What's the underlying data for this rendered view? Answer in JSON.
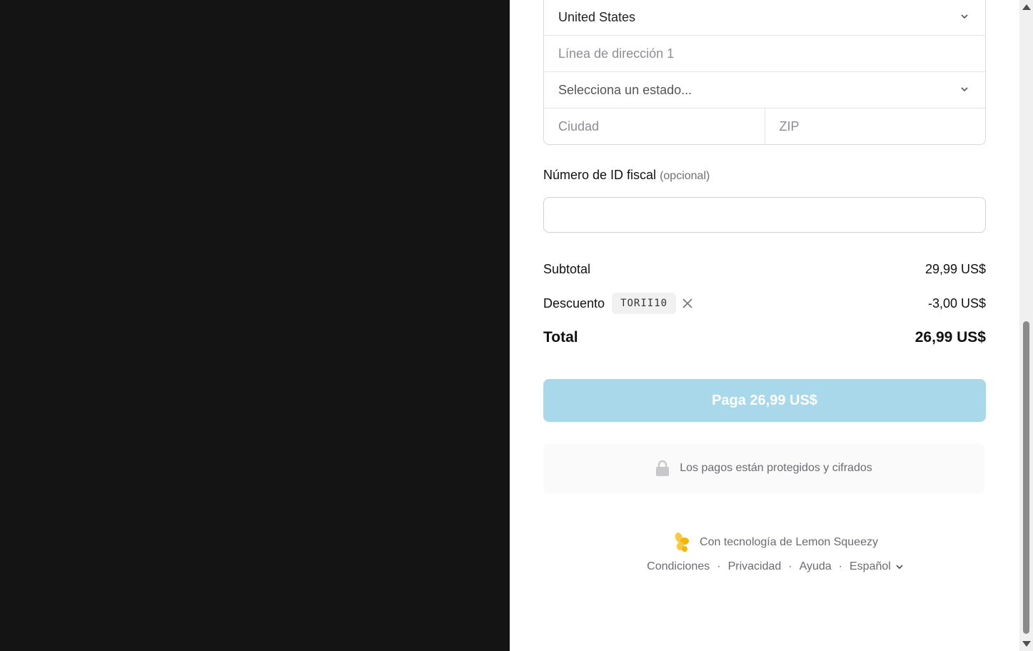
{
  "address": {
    "country": "United States",
    "address_line1_placeholder": "Línea de dirección 1",
    "state_placeholder": "Selecciona un estado...",
    "city_placeholder": "Ciudad",
    "zip_placeholder": "ZIP"
  },
  "tax": {
    "label": "Número de ID fiscal",
    "optional": "(opcional)",
    "value": ""
  },
  "summary": {
    "subtotal_label": "Subtotal",
    "subtotal_value": "29,99 US$",
    "discount_label": "Descuento",
    "coupon_code": "TORII10",
    "discount_value": "-3,00 US$",
    "total_label": "Total",
    "total_value": "26,99 US$"
  },
  "pay_button": {
    "label": "Paga 26,99 US$",
    "color": "#a8d8ea"
  },
  "secure": {
    "text": "Los pagos están protegidos y cifrados",
    "icon": "lock-icon"
  },
  "powered_by": {
    "text": "Con tecnología de Lemon Squeezy",
    "icon": "lemon-squeezy-logo-icon"
  },
  "footer": {
    "links": [
      "Condiciones",
      "Privacidad",
      "Ayuda"
    ],
    "language": "Español"
  }
}
